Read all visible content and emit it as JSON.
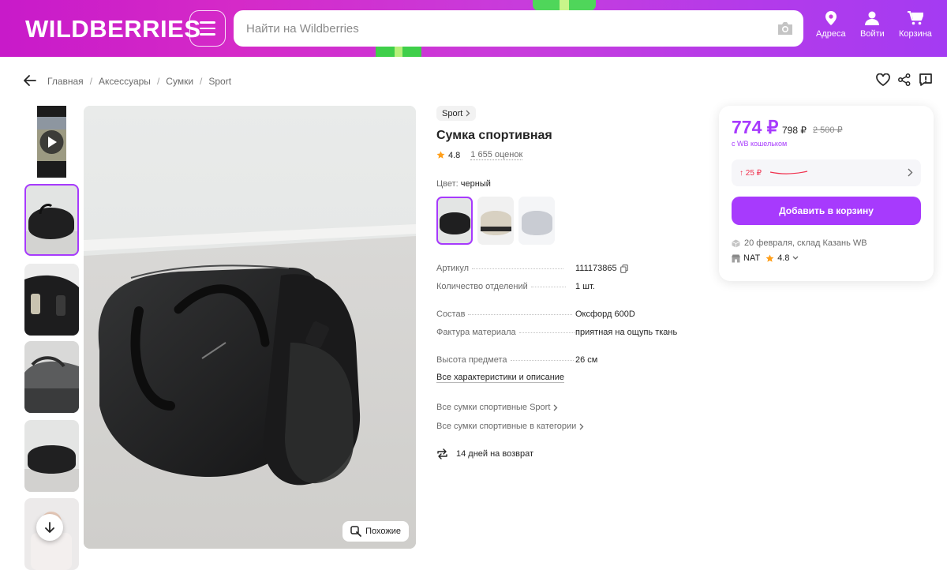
{
  "header": {
    "logo": "WILDBERRIES",
    "search_placeholder": "Найти на Wildberries",
    "nav": [
      {
        "label": "Адреса",
        "icon": "location-pin-icon"
      },
      {
        "label": "Войти",
        "icon": "user-icon"
      },
      {
        "label": "Корзина",
        "icon": "cart-icon"
      }
    ]
  },
  "breadcrumb": [
    "Главная",
    "Аксессуары",
    "Сумки",
    "Sport"
  ],
  "gallery": {
    "thumbnails": 6,
    "active_index": 1,
    "similar_label": "Похожие"
  },
  "product": {
    "brand": "Sport",
    "title": "Сумка спортивная",
    "rating": "4.8",
    "reviews": "1 655 оценок",
    "color_label": "Цвет:",
    "color_value": "черный",
    "color_options": 3,
    "specs": [
      {
        "key": "Артикул",
        "value": "111173865"
      },
      {
        "key": "Количество отделений",
        "value": "1 шт."
      },
      {
        "key": "Состав",
        "value": "Оксфорд 600D"
      },
      {
        "key": "Фактура материала",
        "value": "приятная на ощупь ткань"
      },
      {
        "key": "Высота предмета",
        "value": "26 см"
      }
    ],
    "all_specs_link": "Все характеристики и описание",
    "links": [
      "Все сумки спортивные Sport",
      "Все сумки спортивные в категории"
    ],
    "return_policy": "14 дней на возврат"
  },
  "price_card": {
    "price": "774 ₽",
    "price_without_wallet": "798 ₽",
    "old_price": "2 500 ₽",
    "wallet_note": "с WB кошельком",
    "price_change": "↑ 25 ₽",
    "add_to_cart": "Добавить в корзину",
    "delivery": "20 февраля, склад Казань WB",
    "seller": "NAT",
    "seller_rating": "4.8"
  },
  "colors": {
    "accent": "#a73afd",
    "header_start": "#c81ac9",
    "header_end": "#a43bf2",
    "price_up": "#f0314e"
  }
}
